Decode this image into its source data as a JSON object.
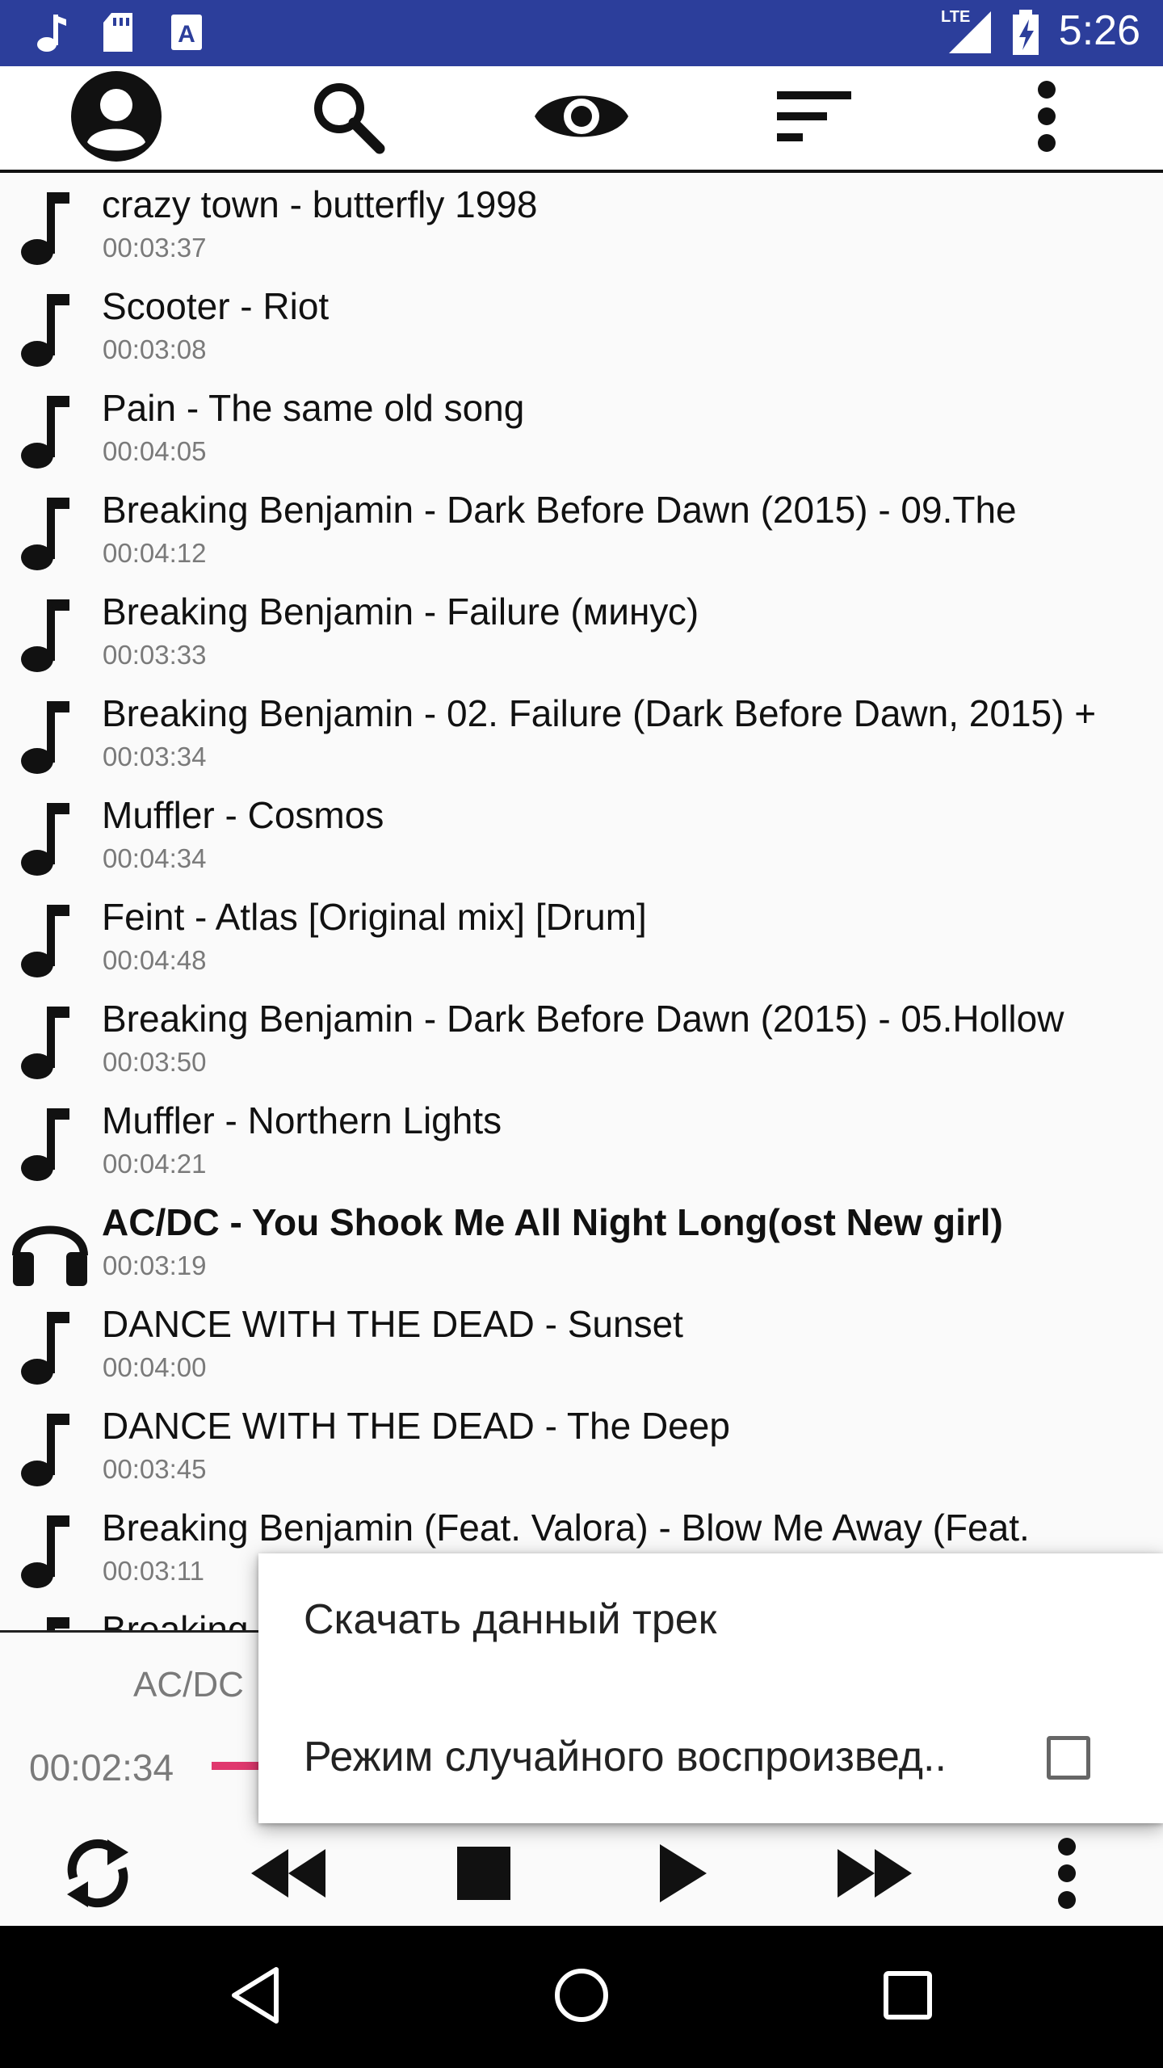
{
  "status_bar": {
    "time": "5:26",
    "network_label": "LTE",
    "icons": [
      "music-note-icon",
      "sd-card-icon",
      "keyboard-a-icon",
      "signal-icon",
      "battery-charging-icon"
    ]
  },
  "toolbar": {
    "icons": [
      "account-icon",
      "search-icon",
      "eye-icon",
      "sort-icon",
      "more-vert-icon"
    ]
  },
  "tracks": [
    {
      "title": "crazy town - butterfly 1998",
      "duration": "00:03:37",
      "icon": "music-note-icon",
      "playing": false
    },
    {
      "title": "Scooter - Riot",
      "duration": "00:03:08",
      "icon": "music-note-icon",
      "playing": false
    },
    {
      "title": "Pain - The same old song",
      "duration": "00:04:05",
      "icon": "music-note-icon",
      "playing": false
    },
    {
      "title": "Breaking Benjamin - Dark Before Dawn (2015) - 09.The",
      "duration": "00:04:12",
      "icon": "music-note-icon",
      "playing": false
    },
    {
      "title": "Breaking Benjamin - Failure (минус)",
      "duration": "00:03:33",
      "icon": "music-note-icon",
      "playing": false
    },
    {
      "title": "Breaking Benjamin - 02. Failure (Dark Before Dawn, 2015) +",
      "duration": "00:03:34",
      "icon": "music-note-icon",
      "playing": false
    },
    {
      "title": "Muffler - Cosmos",
      "duration": "00:04:34",
      "icon": "music-note-icon",
      "playing": false
    },
    {
      "title": "Feint - Atlas [Original mix] [Drum]",
      "duration": "00:04:48",
      "icon": "music-note-icon",
      "playing": false
    },
    {
      "title": "Breaking Benjamin - Dark Before Dawn (2015) - 05.Hollow",
      "duration": "00:03:50",
      "icon": "music-note-icon",
      "playing": false
    },
    {
      "title": "Muffler - Northern Lights",
      "duration": "00:04:21",
      "icon": "music-note-icon",
      "playing": false
    },
    {
      "title": "AC/DC - You Shook Me All Night Long(ost New girl)",
      "duration": "00:03:19",
      "icon": "headphones-icon",
      "playing": true
    },
    {
      "title": "DANCE WITH THE DEAD - Sunset",
      "duration": "00:04:00",
      "icon": "music-note-icon",
      "playing": false
    },
    {
      "title": "DANCE WITH THE DEAD - The Deep",
      "duration": "00:03:45",
      "icon": "music-note-icon",
      "playing": false
    },
    {
      "title": "Breaking Benjamin (Feat. Valora) - Blow Me Away (Feat.",
      "duration": "00:03:11",
      "icon": "music-note-icon",
      "playing": false
    },
    {
      "title": "Breaking",
      "duration": "",
      "icon": "music-note-icon",
      "playing": false
    }
  ],
  "player": {
    "artist": "AC/DC",
    "elapsed": "00:02:34",
    "progress_fraction": 0.08,
    "controls": [
      "repeat-icon",
      "rewind-icon",
      "stop-icon",
      "play-icon",
      "fast-forward-icon",
      "more-vert-icon"
    ]
  },
  "popup_menu": {
    "items": [
      {
        "label": "Скачать данный трек"
      },
      {
        "label": "Режим случайного воспроизвед..",
        "checked": false
      }
    ]
  },
  "nav_bar": {
    "icons": [
      "back-icon",
      "home-icon",
      "recents-icon"
    ]
  },
  "colors": {
    "status_bar": "#2c3e9b",
    "accent": "#e0386e"
  }
}
